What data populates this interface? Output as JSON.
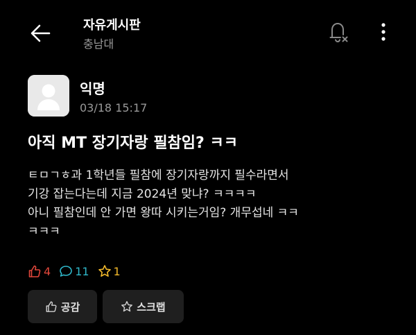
{
  "header": {
    "title": "자유게시판",
    "subtitle": "충남대"
  },
  "post": {
    "author": "익명",
    "time": "03/18 15:17",
    "title": "아직 MT 장기자랑 필참임? ㅋㅋ",
    "body_lines": [
      "ㅌㅁㄱㅎ과 1학년들 필참에 장기자랑까지 필수라면서",
      "기강 잡는다는데 지금 2024년 맞냐? ㅋㅋㅋㅋ",
      "아니 필참인데 안 가면 왕따 시키는거임? 개무섭네 ㅋㅋ",
      "ㅋㅋㅋ"
    ]
  },
  "stats": {
    "likes": "4",
    "comments": "11",
    "scraps": "1"
  },
  "actions": {
    "like_label": "공감",
    "scrap_label": "스크랩"
  },
  "colors": {
    "background": "#000000",
    "like": "#e2473b",
    "comment": "#2fb7c9",
    "scrap": "#f2b92b",
    "button_bg": "#1f1f1f"
  },
  "icons": {
    "back": "arrow-left-icon",
    "notification": "bell-off-icon",
    "more": "more-vertical-icon",
    "like": "thumbs-up-icon",
    "comment": "speech-bubble-icon",
    "scrap": "star-icon"
  }
}
